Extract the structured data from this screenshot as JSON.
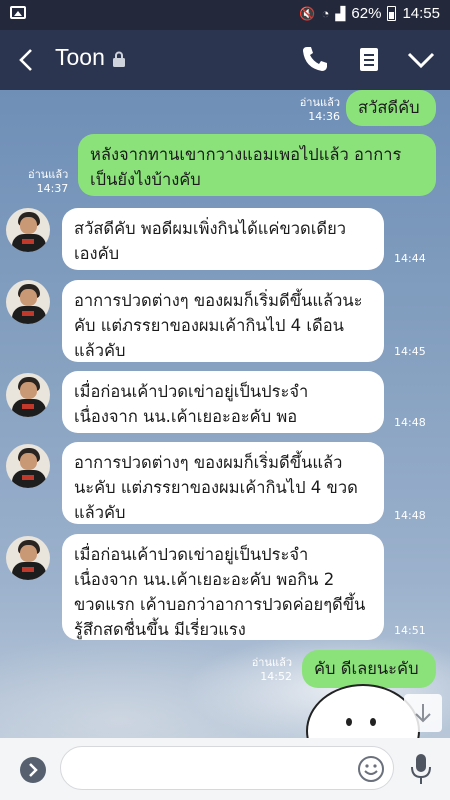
{
  "status_bar": {
    "battery": "62%",
    "time": "14:55"
  },
  "header": {
    "title": "Toon"
  },
  "messages": [
    {
      "dir": "out",
      "lines": [
        "สวัสดีคับ"
      ],
      "read": "อ่านแล้ว",
      "time": "14:36"
    },
    {
      "dir": "out",
      "lines": [
        "หลังจากทานเขากวางแอมเพอไปแล้ว อาการ",
        "เป็นยังไงบ้างคับ"
      ],
      "read": "อ่านแล้ว",
      "time": "14:37"
    },
    {
      "dir": "in",
      "lines": [
        "สวัสดีคับ พอดีผมเพิ่งกินได้แค่ขวดเดียว",
        "เองคับ"
      ],
      "time": "14:44"
    },
    {
      "dir": "in",
      "lines": [
        "อาการปวดต่างๆ ของผมก็เริ่มดีขึ้นแล้วนะ",
        "คับ แต่ภรรยาของผมเค้ากินไป 4 เดือน",
        "แล้วคับ"
      ],
      "time": "14:45"
    },
    {
      "dir": "in",
      "lines": [
        "เมื่อก่อนเค้าปวดเข่าอยู่เป็นประจำ",
        "เนื่องจาก นน.เค้าเยอะอะคับ พอ"
      ],
      "time": "14:48"
    },
    {
      "dir": "in",
      "lines": [
        "อาการปวดต่างๆ ของผมก็เริ่มดีขึ้นแล้ว",
        "นะคับ แต่ภรรยาของผมเค้ากินไป 4 ขวด",
        "แล้วคับ"
      ],
      "time": "14:48"
    },
    {
      "dir": "in",
      "lines": [
        "เมื่อก่อนเค้าปวดเข่าอยู่เป็นประจำ",
        "เนื่องจาก นน.เค้าเยอะอะคับ พอกิน 2",
        "ขวดแรก เค้าบอกว่าอาการปวดค่อยๆดีขึ้น",
        "รู้สึกสดชื่นขึ้น มีเรี่ยวแรง"
      ],
      "time": "14:51"
    },
    {
      "dir": "out",
      "lines": [
        "คับ ดีเลยนะคับ"
      ],
      "read": "อ่านแล้ว",
      "time": "14:52"
    }
  ],
  "icons": {
    "back": "back-arrow-icon",
    "lock": "lock-icon",
    "call": "phone-icon",
    "notes": "note-icon",
    "menu": "chevron-down-icon",
    "plus": "chevron-right-icon",
    "emoji": "smiley-icon",
    "mic": "microphone-icon",
    "scroll": "arrow-down-icon"
  },
  "colors": {
    "outgoing": "#8be27a",
    "incoming": "#ffffff",
    "header": "#2c3550"
  }
}
